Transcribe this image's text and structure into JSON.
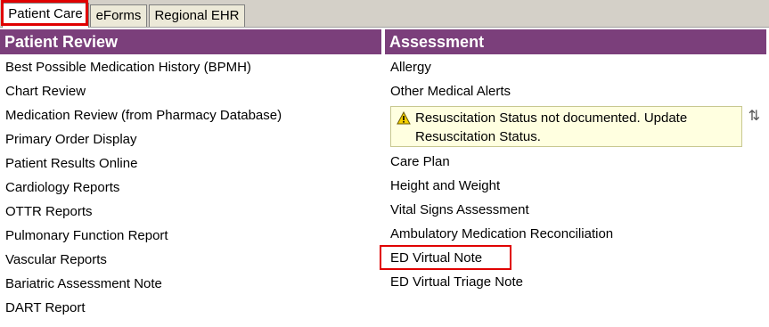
{
  "tabs": [
    {
      "label": "Patient Care"
    },
    {
      "label": "eForms"
    },
    {
      "label": "Regional EHR"
    }
  ],
  "patient_review": {
    "title": "Patient Review",
    "items": [
      "Best Possible Medication History (BPMH)",
      "Chart Review",
      "Medication Review (from Pharmacy Database)",
      "Primary Order Display",
      "Patient Results Online",
      "Cardiology Reports",
      "OTTR Reports",
      "Pulmonary Function Report",
      "Vascular Reports",
      "Bariatric Assessment Note",
      "DART Report"
    ]
  },
  "assessment": {
    "title": "Assessment",
    "items_before_alert": [
      "Allergy",
      "Other Medical Alerts"
    ],
    "alert": {
      "line1": "Resuscitation Status not documented. Update",
      "line2": "Resuscitation Status.",
      "icon": "warning-icon"
    },
    "items_after_alert": [
      "Care Plan",
      "Height and Weight",
      "Vital Signs Assessment",
      "Ambulatory Medication Reconciliation",
      "ED Virtual Note",
      "ED Virtual Triage Note"
    ]
  },
  "colors": {
    "header": "#7b3f7b",
    "highlight": "#e00000",
    "alert_bg": "#ffffe0"
  }
}
